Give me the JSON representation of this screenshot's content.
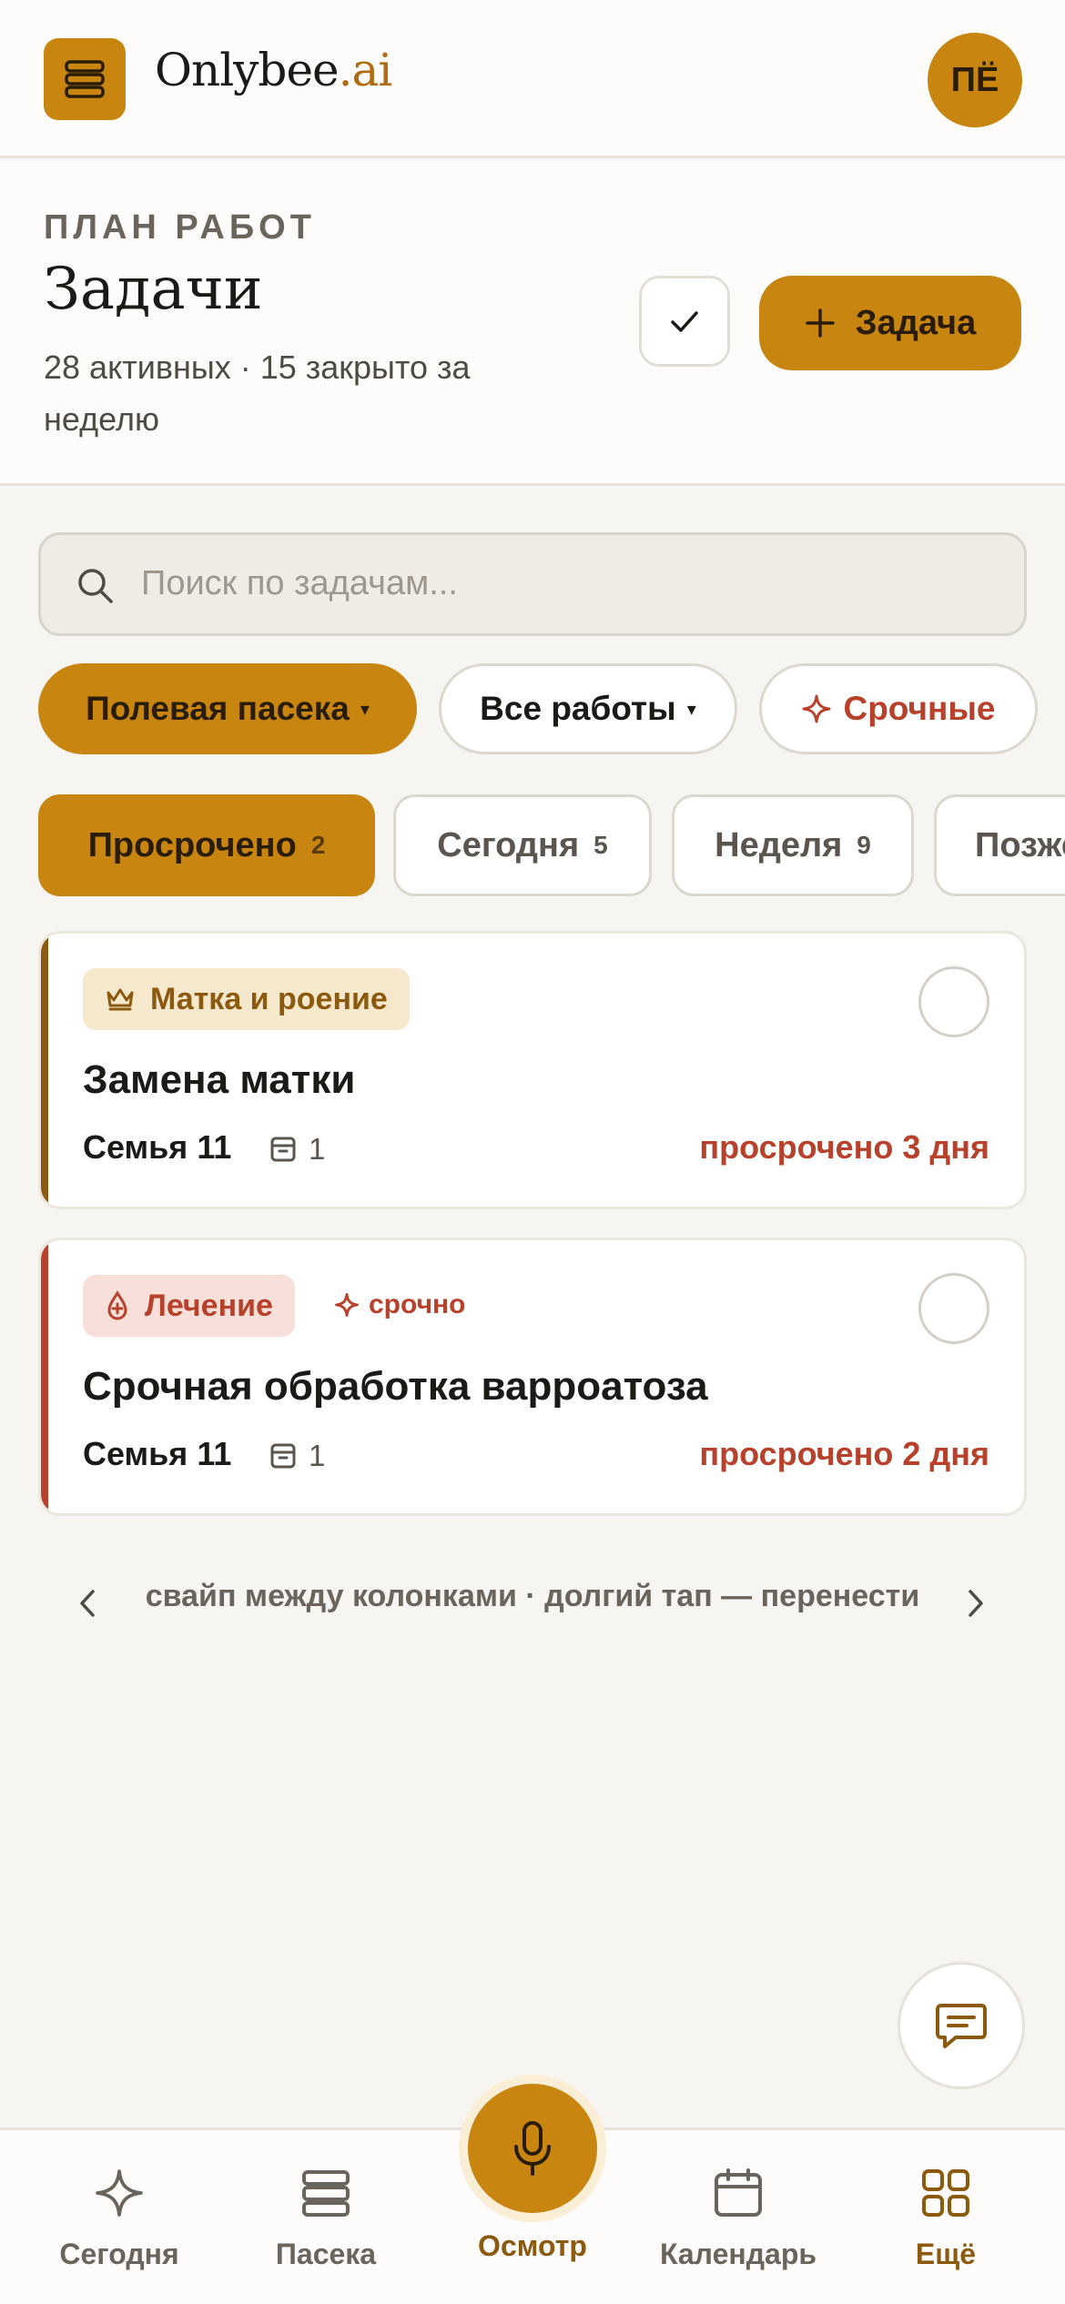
{
  "app": {
    "logo_main": "Onlybee",
    "logo_suffix": ".ai",
    "avatar_initials": "ПЁ"
  },
  "header": {
    "eyebrow": "ПЛАН РАБОТ",
    "title": "Задачи",
    "subtitle": "28 активных · 15 закрыто за неделю",
    "add_label": "Задача"
  },
  "search": {
    "placeholder": "Поиск по задачам..."
  },
  "filters": [
    {
      "label": "Полевая пасека",
      "caret": "▾"
    },
    {
      "label": "Все работы",
      "caret": "▾"
    },
    {
      "label": "Срочные"
    }
  ],
  "tabs": [
    {
      "label": "Просрочено",
      "count": "2"
    },
    {
      "label": "Сегодня",
      "count": "5"
    },
    {
      "label": "Неделя",
      "count": "9"
    },
    {
      "label": "Позже"
    }
  ],
  "tasks": [
    {
      "tag": "Матка и роение",
      "title": "Замена матки",
      "family": "Семья 11",
      "hive_count": "1",
      "due": "просрочено 3 дня",
      "accent": "#8c5a0e"
    },
    {
      "tag": "Лечение",
      "flag": "срочно",
      "title": "Срочная обработка варроатоза",
      "family": "Семья 11",
      "hive_count": "1",
      "due": "просрочено 2 дня",
      "accent": "#b8412b"
    }
  ],
  "hint": "свайп между колонками · долгий тап — перенести",
  "nav": [
    {
      "label": "Сегодня",
      "icon": "sparkle-icon"
    },
    {
      "label": "Пасека",
      "icon": "stack-icon"
    },
    {
      "label": "Осмотр",
      "icon": "mic-icon"
    },
    {
      "label": "Календарь",
      "icon": "calendar-icon"
    },
    {
      "label": "Ещё",
      "icon": "grid-icon"
    }
  ],
  "colors": {
    "accent": "#c8850f",
    "danger": "#b8412b",
    "background": "#f7f5f1"
  }
}
